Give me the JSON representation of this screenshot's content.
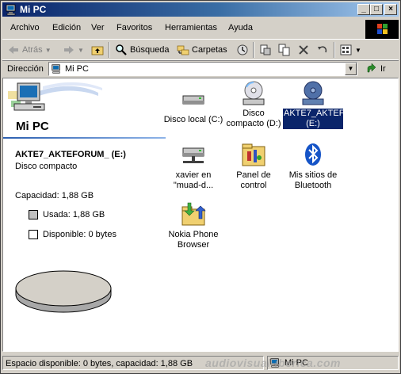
{
  "window": {
    "title": "Mi PC"
  },
  "controls": {
    "minimize": "_",
    "maximize": "□",
    "close": "×"
  },
  "menu": {
    "items": [
      {
        "label": "Archivo"
      },
      {
        "label": "Edición"
      },
      {
        "label": "Ver"
      },
      {
        "label": "Favoritos"
      },
      {
        "label": "Herramientas"
      },
      {
        "label": "Ayuda"
      }
    ]
  },
  "toolbar": {
    "back_label": "Atrás",
    "search_label": "Búsqueda",
    "folders_label": "Carpetas"
  },
  "address": {
    "label": "Dirección",
    "value": "Mi PC",
    "go_label": "Ir"
  },
  "left_pane": {
    "banner_title": "Mi PC",
    "item_title": "AKTE7_AKTEFORUM_ (E:)",
    "item_type": "Disco compacto",
    "capacity": "Capacidad: 1,88 GB",
    "used": "Usada: 1,88 GB",
    "free": "Disponible: 0 bytes",
    "used_color": "#c0c0c0",
    "free_color": "#ffffff"
  },
  "icons": [
    {
      "name": "Disco local (C:)",
      "icon": "hard-drive-icon"
    },
    {
      "name": "Disco compacto (D:)",
      "icon": "cd-drive-icon"
    },
    {
      "name": "AKTE7_AKTEFORUM_ (E:)",
      "icon": "dvd-drive-icon",
      "selected": true
    },
    {
      "name": "xavier en \"muad-d...",
      "icon": "network-drive-icon"
    },
    {
      "name": "Panel de control",
      "icon": "control-panel-icon"
    },
    {
      "name": "Mis sitios de Bluetooth",
      "icon": "bluetooth-icon"
    },
    {
      "name": "Nokia Phone Browser",
      "icon": "nokia-browser-icon"
    }
  ],
  "status": {
    "text": "Espacio disponible: 0 bytes, capacidad: 1,88 GB",
    "zone": "Mi PC"
  },
  "watermark": "audiovisual-iberica.com",
  "colors": {
    "title_start": "#0a246a",
    "title_end": "#a6caf0",
    "selection": "#0a246a",
    "face": "#d4d0c8"
  }
}
